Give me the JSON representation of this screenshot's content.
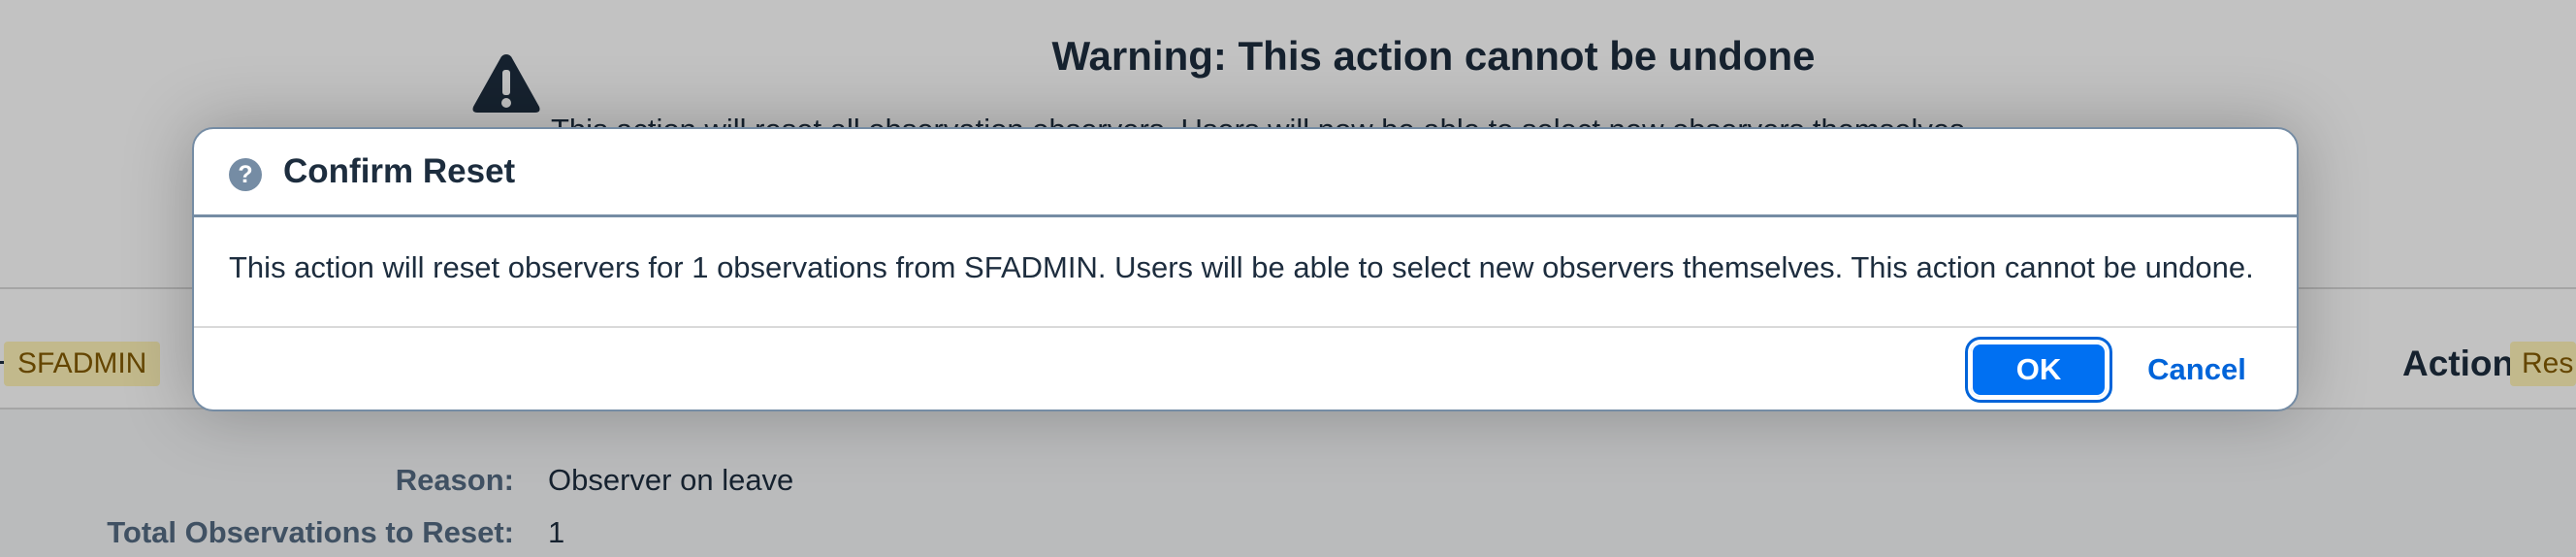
{
  "background": {
    "warning_title": "Warning: This action cannot be undone",
    "warning_text": "This action will reset all observation observers. Users will now be able to select new observers themselves.",
    "user_tag": "SFADMIN",
    "action_label": "Action",
    "action_tag": "Res",
    "reason_label": "Reason:",
    "reason_value": "Observer on leave",
    "total_label": "Total Observations to Reset:",
    "total_value": "1",
    "icons": {
      "warning": "warning-triangle-icon"
    }
  },
  "dialog": {
    "title": "Confirm Reset",
    "help_glyph": "?",
    "message": "This action will reset observers for 1 observations from SFADMIN. Users will be able to select new observers themselves. This action cannot be undone.",
    "ok_label": "OK",
    "cancel_label": "Cancel",
    "icons": {
      "header": "help-circle-icon"
    }
  },
  "colors": {
    "primary": "#0070f2",
    "link": "#0064d9",
    "text": "#1d2d3e",
    "label": "#556b82",
    "dialog_border": "#758ca4",
    "tag_bg": "#fff3b8",
    "tag_text": "#845b00"
  }
}
